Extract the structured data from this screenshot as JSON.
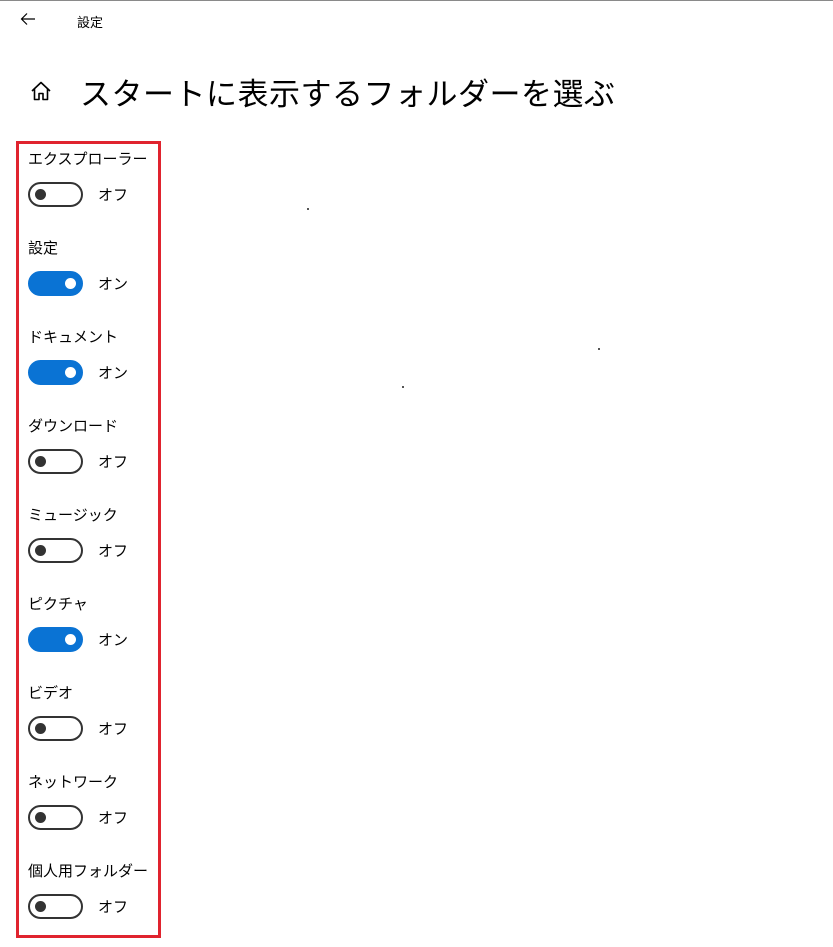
{
  "titlebar": {
    "app_title": "設定",
    "back_icon": "arrow-left-icon"
  },
  "heading": {
    "title": "スタートに表示するフォルダーを選ぶ",
    "home_icon": "home-icon"
  },
  "accent_color": "#0a73d4",
  "highlight_color": "#e0232e",
  "settings": [
    {
      "label": "エクスプローラー",
      "state": "オフ",
      "on": false
    },
    {
      "label": "設定",
      "state": "オン",
      "on": true
    },
    {
      "label": "ドキュメント",
      "state": "オン",
      "on": true
    },
    {
      "label": "ダウンロード",
      "state": "オフ",
      "on": false
    },
    {
      "label": "ミュージック",
      "state": "オフ",
      "on": false
    },
    {
      "label": "ピクチャ",
      "state": "オン",
      "on": true
    },
    {
      "label": "ビデオ",
      "state": "オフ",
      "on": false
    },
    {
      "label": "ネットワーク",
      "state": "オフ",
      "on": false
    },
    {
      "label": "個人用フォルダー",
      "state": "オフ",
      "on": false
    }
  ]
}
